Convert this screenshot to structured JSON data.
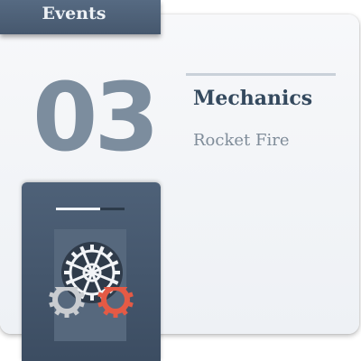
{
  "tab": {
    "label": "Events"
  },
  "card": {
    "number": "03",
    "category": "Mechanics",
    "title": "Rocket Fire"
  },
  "panel": {
    "progress": 0.65,
    "icon": "gears-icon"
  },
  "colors": {
    "tab": "#4e6178",
    "number": "#7c8d9e",
    "category": "#34495e",
    "subtitle": "#7f8c99",
    "gear_white": "#f2f4f7",
    "gear_grey": "#c9ccd0",
    "gear_red": "#e45a45",
    "gear_dark": "#2f3b4a"
  }
}
